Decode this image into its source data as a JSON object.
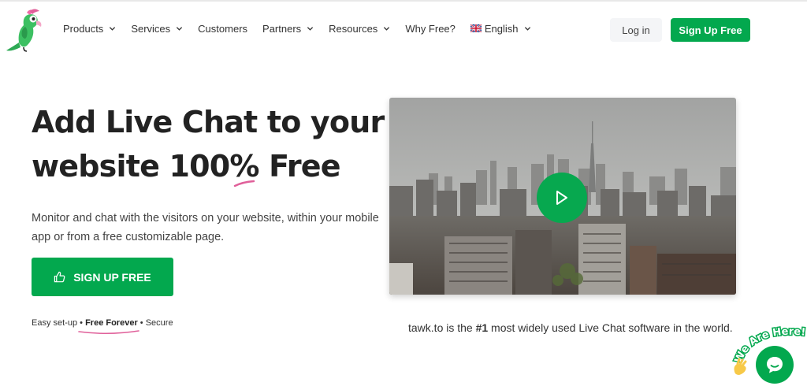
{
  "header": {
    "nav": [
      {
        "label": "Products",
        "has_dropdown": true
      },
      {
        "label": "Services",
        "has_dropdown": true
      },
      {
        "label": "Customers",
        "has_dropdown": false
      },
      {
        "label": "Partners",
        "has_dropdown": true
      },
      {
        "label": "Resources",
        "has_dropdown": true
      },
      {
        "label": "Why Free?",
        "has_dropdown": false
      },
      {
        "label": "English",
        "has_dropdown": true,
        "icon": "uk-flag-icon"
      }
    ],
    "login_label": "Log in",
    "signup_label": "Sign Up Free"
  },
  "hero": {
    "title_line1": "Add Live Chat to your",
    "title_line2": "website 100% Free",
    "description": "Monitor and chat with the visitors on your website, within your mobile app or from a free customizable page.",
    "cta_label": "SIGN UP FREE",
    "features": {
      "item1": "Easy set-up",
      "item2": "Free Forever",
      "item3": "Secure",
      "separator": "•"
    }
  },
  "video": {
    "tagline_prefix": "tawk.to is the ",
    "tagline_bold": "#1",
    "tagline_suffix": " most widely used Live Chat software in the world."
  },
  "chat_widget": {
    "badge_text": "We Are Here!"
  },
  "colors": {
    "brand_green": "#03a84e",
    "accent_pink": "#e0609a",
    "title_text": "#222222"
  }
}
